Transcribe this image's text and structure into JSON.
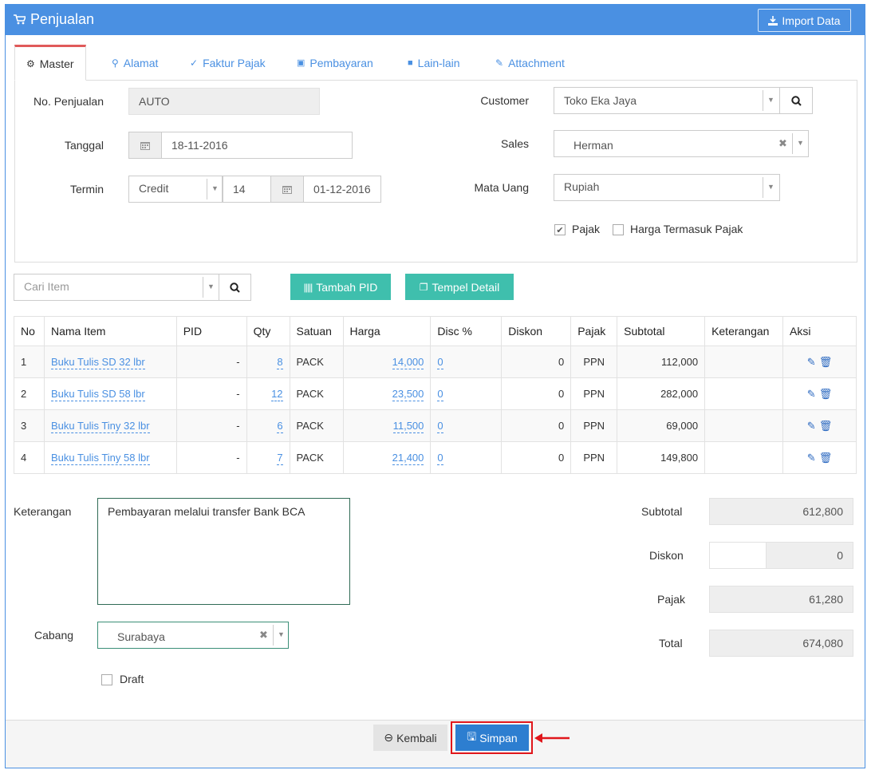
{
  "header": {
    "title": "Penjualan",
    "title_icon": "cart-icon",
    "import_label": "Import Data",
    "import_icon": "download-icon",
    "brand_color": "#4a90e2"
  },
  "tabs": [
    {
      "label": "Master",
      "icon": "cogs-icon"
    },
    {
      "label": "Alamat",
      "icon": "map-marker-icon"
    },
    {
      "label": "Faktur Pajak",
      "icon": "check-circle-icon"
    },
    {
      "label": "Pembayaran",
      "icon": "money-icon"
    },
    {
      "label": "Lain-lain",
      "icon": "truck-icon"
    },
    {
      "label": "Attachment",
      "icon": "paperclip-icon"
    }
  ],
  "form": {
    "no_penjualan_label": "No. Penjualan",
    "no_penjualan_value": "AUTO",
    "tanggal_label": "Tanggal",
    "tanggal_value": "18-11-2016",
    "termin_label": "Termin",
    "termin_type": "Credit",
    "termin_days": "14",
    "termin_due": "01-12-2016",
    "customer_label": "Customer",
    "customer_value": "Toko Eka Jaya",
    "sales_label": "Sales",
    "sales_value": "Herman",
    "mata_uang_label": "Mata Uang",
    "mata_uang_value": "Rupiah",
    "pajak_label": "Pajak",
    "pajak_checked": true,
    "harga_termasuk_pajak_label": "Harga Termasuk Pajak",
    "harga_termasuk_pajak_checked": false
  },
  "toolbar": {
    "cari_item_placeholder": "Cari Item",
    "tambah_pid_label": "Tambah PID",
    "tempel_detail_label": "Tempel Detail",
    "accent_color": "#3fbfad"
  },
  "table": {
    "headers": [
      "No",
      "Nama Item",
      "PID",
      "Qty",
      "Satuan",
      "Harga",
      "Disc %",
      "Diskon",
      "Pajak",
      "Subtotal",
      "Keterangan",
      "Aksi"
    ],
    "rows": [
      {
        "no": "1",
        "nama": "Buku Tulis SD 32 lbr",
        "pid": "-",
        "qty": "8",
        "satuan": "PACK",
        "harga": "14,000",
        "disc": "0",
        "diskon": "0",
        "pajak": "PPN",
        "subtotal": "112,000",
        "keterangan": ""
      },
      {
        "no": "2",
        "nama": "Buku Tulis SD 58 lbr",
        "pid": "-",
        "qty": "12",
        "satuan": "PACK",
        "harga": "23,500",
        "disc": "0",
        "diskon": "0",
        "pajak": "PPN",
        "subtotal": "282,000",
        "keterangan": ""
      },
      {
        "no": "3",
        "nama": "Buku Tulis Tiny 32 lbr",
        "pid": "-",
        "qty": "6",
        "satuan": "PACK",
        "harga": "11,500",
        "disc": "0",
        "diskon": "0",
        "pajak": "PPN",
        "subtotal": "69,000",
        "keterangan": ""
      },
      {
        "no": "4",
        "nama": "Buku Tulis Tiny 58 lbr",
        "pid": "-",
        "qty": "7",
        "satuan": "PACK",
        "harga": "21,400",
        "disc": "0",
        "diskon": "0",
        "pajak": "PPN",
        "subtotal": "149,800",
        "keterangan": ""
      }
    ]
  },
  "bottom": {
    "keterangan_label": "Keterangan",
    "keterangan_value": "Pembayaran melalui transfer Bank BCA",
    "cabang_label": "Cabang",
    "cabang_value": "Surabaya",
    "draft_label": "Draft",
    "draft_checked": false
  },
  "summary": {
    "subtotal_label": "Subtotal",
    "subtotal_value": "612,800",
    "diskon_label": "Diskon",
    "diskon_input": "",
    "diskon_value": "0",
    "pajak_label": "Pajak",
    "pajak_value": "61,280",
    "total_label": "Total",
    "total_value": "674,080"
  },
  "footer": {
    "kembali_label": "Kembali",
    "simpan_label": "Simpan",
    "highlight_color": "#e0161b"
  }
}
